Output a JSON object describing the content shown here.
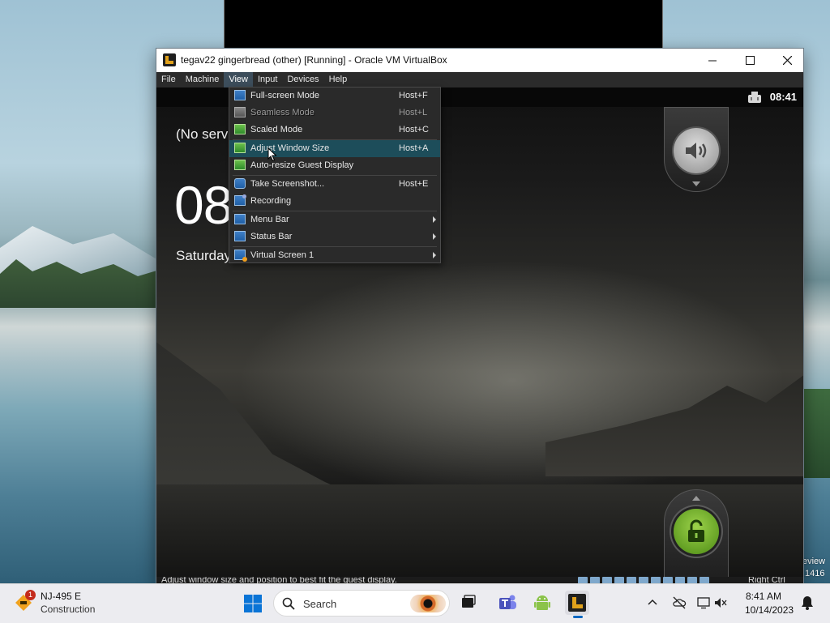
{
  "window": {
    "title": "tegav22 gingerbread (other) [Running] - Oracle VM VirtualBox",
    "minimize": "—",
    "close": "✕"
  },
  "menubar": [
    "File",
    "Machine",
    "View",
    "Input",
    "Devices",
    "Help"
  ],
  "view_menu": [
    {
      "label": "Full-screen Mode",
      "shortcut": "Host+F"
    },
    {
      "label": "Seamless Mode",
      "shortcut": "Host+L",
      "disabled": true
    },
    {
      "label": "Scaled Mode",
      "shortcut": "Host+C"
    },
    {
      "label": "Adjust Window Size",
      "shortcut": "Host+A",
      "highlighted": true
    },
    {
      "label": "Auto-resize Guest Display",
      "shortcut": ""
    },
    {
      "label": "Take Screenshot...",
      "shortcut": "Host+E"
    },
    {
      "label": "Recording",
      "shortcut": ""
    },
    {
      "label": "Menu Bar",
      "shortcut": "",
      "submenu": true
    },
    {
      "label": "Status Bar",
      "shortcut": "",
      "submenu": true
    },
    {
      "label": "Virtual Screen 1",
      "shortcut": "",
      "submenu": true
    }
  ],
  "guest": {
    "clock": "08:41",
    "no_service": "(No serv",
    "big_time": "08",
    "date": "Saturday"
  },
  "statusbar": {
    "hint": "Adjust window size and position to best fit the guest display.",
    "host_key": "Right Ctrl"
  },
  "desktop": {
    "edge_line1": "eview",
    "edge_line2": ".1416"
  },
  "taskbar": {
    "weather_badge": "1",
    "weather_title": "NJ-495 E",
    "weather_sub": "Construction",
    "search_placeholder": "Search",
    "time": "8:41 AM",
    "date": "10/14/2023"
  },
  "colors": {
    "menu_highlight": "#1d4d5a",
    "accent": "#0067c0",
    "lock_green": "#6cbf2a"
  }
}
